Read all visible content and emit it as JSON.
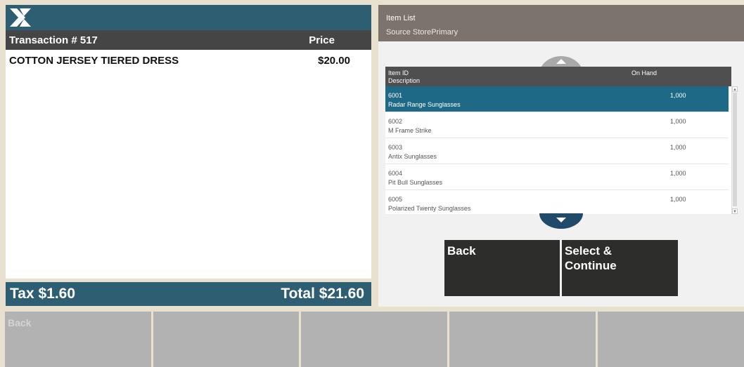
{
  "logo": {
    "icon": "x-logo-icon"
  },
  "transaction": {
    "title": "Transaction # 517",
    "price_header": "Price",
    "items": [
      {
        "description": "COTTON JERSEY TIERED DRESS",
        "price": "$20.00"
      }
    ]
  },
  "totals": {
    "tax": "Tax $1.60",
    "total": "Total $21.60"
  },
  "item_list": {
    "title": "Item List",
    "source": "Source StorePrimary",
    "headers": {
      "item_id": "Item ID",
      "description": "Description",
      "on_hand": "On Hand"
    },
    "rows": [
      {
        "id": "6001",
        "description": "Radar Range Sunglasses",
        "on_hand": "1,000",
        "selected": true
      },
      {
        "id": "6002",
        "description": "M Frame Strike",
        "on_hand": "1,000",
        "selected": false
      },
      {
        "id": "6003",
        "description": "Antix Sunglasses",
        "on_hand": "1,000",
        "selected": false
      },
      {
        "id": "6004",
        "description": "Pit Bull Sunglasses",
        "on_hand": "1,000",
        "selected": false
      },
      {
        "id": "6005",
        "description": "Polarized Twenty Sunglasses",
        "on_hand": "1,000",
        "selected": false
      }
    ],
    "scroll_up_icon": "chevron-up-icon",
    "scroll_down_icon": "chevron-down-icon"
  },
  "actions": {
    "back": "Back",
    "select_continue": "Select &\nContinue"
  },
  "function_keys": [
    "Back",
    "",
    "",
    "",
    ""
  ],
  "colors": {
    "header_teal": "#2e5e71",
    "selected_row": "#1e6a86",
    "dark_header": "#454545",
    "action_button": "#2d2d2b",
    "function_key": "#b2b2b2"
  }
}
